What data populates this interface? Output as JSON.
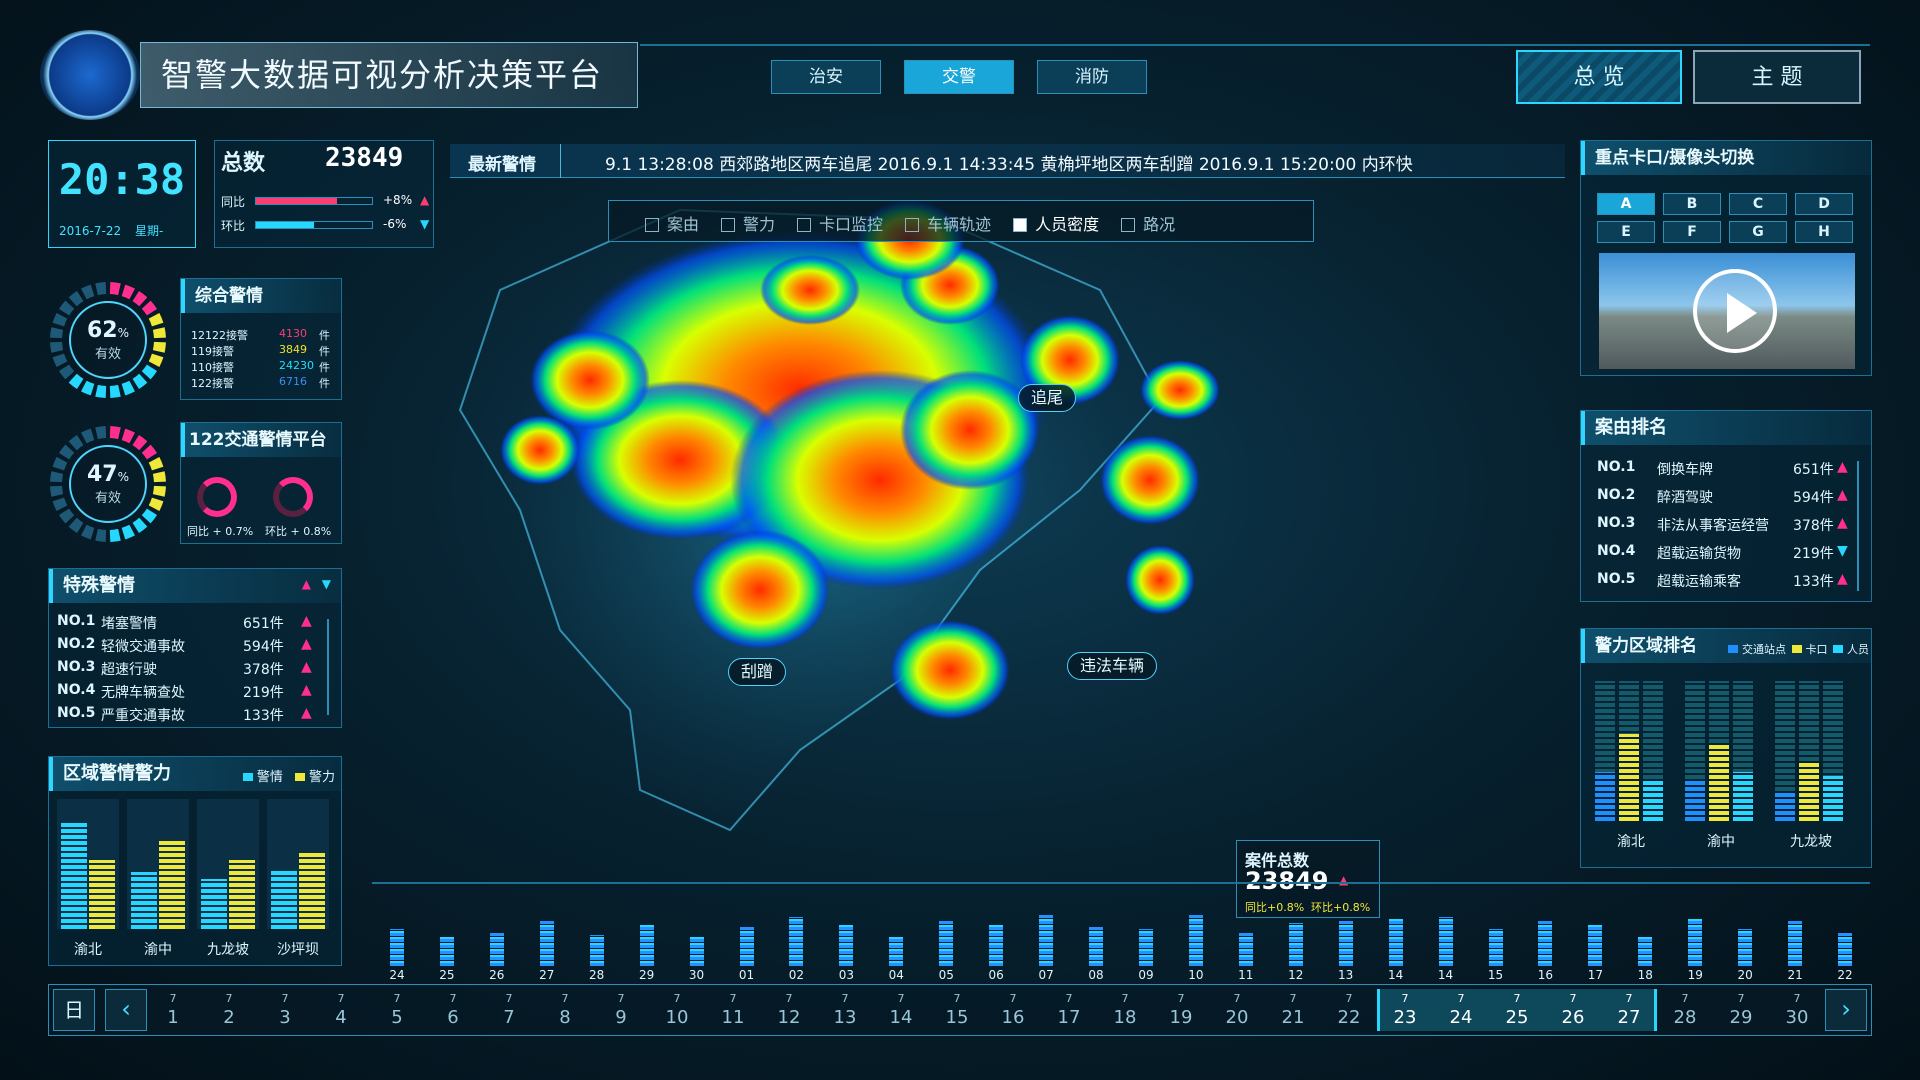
{
  "header": {
    "title": "智警大数据可视分析决策平台",
    "tabs": [
      "治安",
      "交警",
      "消防"
    ],
    "active_tab_index": 1,
    "right_buttons": [
      "总 览",
      "主 题"
    ]
  },
  "clock": {
    "time": "20:38",
    "date": "2016-7-22",
    "weekday": "星期-"
  },
  "totals": {
    "label": "总数",
    "value": "23849",
    "tongbi_label": "同比",
    "tongbi_value": "+8%",
    "tongbi_fill": 0.7,
    "huanbi_label": "环比",
    "huanbi_value": "-6%",
    "huanbi_fill": 0.5
  },
  "alerts": {
    "label": "最新警情",
    "ticker": "9.1 13:28:08 西郊路地区两车追尾    2016.9.1  14:33:45  黄桷坪地区两车刮蹭    2016.9.1  15:20:00  内环快"
  },
  "map_filters": [
    {
      "label": "案由",
      "checked": false
    },
    {
      "label": "警力",
      "checked": false
    },
    {
      "label": "卡口监控",
      "checked": false
    },
    {
      "label": "车辆轨迹",
      "checked": false
    },
    {
      "label": "人员密度",
      "checked": true
    },
    {
      "label": "路况",
      "checked": false
    }
  ],
  "map_tags": [
    "追尾",
    "刮蹭",
    "违法车辆"
  ],
  "zonghe": {
    "title": "综合警情",
    "ring_percent": "62",
    "ring_unit": "%",
    "ring_label": "有效",
    "ring_fraction": 0.62,
    "rows": [
      {
        "label": "12122接警",
        "value": "4130",
        "unit": "件",
        "color": "#ff3b74"
      },
      {
        "label": "119接警",
        "value": "3849",
        "unit": "件",
        "color": "#f3e22a"
      },
      {
        "label": "110接警",
        "value": "24230",
        "unit": "件",
        "color": "#20dfff"
      },
      {
        "label": "122接警",
        "value": "6716",
        "unit": "件",
        "color": "#3a8df4"
      }
    ]
  },
  "jiaotong": {
    "title": "122交通警情平台",
    "ring_percent": "47",
    "ring_unit": "%",
    "ring_label": "有效",
    "ring_fraction": 0.47,
    "tongbi": "同比 + 0.7%",
    "huanbi": "环比 + 0.8%"
  },
  "teshu": {
    "title": "特殊警情",
    "rows": [
      {
        "rank": "NO.1",
        "name": "堵塞警情",
        "count": "651件",
        "trend": "up"
      },
      {
        "rank": "NO.2",
        "name": "轻微交通事故",
        "count": "594件",
        "trend": "up"
      },
      {
        "rank": "NO.3",
        "name": "超速行驶",
        "count": "378件",
        "trend": "up"
      },
      {
        "rank": "NO.4",
        "name": "无牌车辆查处",
        "count": "219件",
        "trend": "up"
      },
      {
        "rank": "NO.5",
        "name": "严重交通事故",
        "count": "133件",
        "trend": "up"
      }
    ]
  },
  "quyu": {
    "title": "区域警情警力",
    "legend": [
      {
        "label": "警情",
        "color": "#26d8ff"
      },
      {
        "label": "警力",
        "color": "#f0e838"
      }
    ],
    "regions": [
      {
        "name": "渝北",
        "jingqing": 0.85,
        "jingli": 0.55
      },
      {
        "name": "渝中",
        "jingqing": 0.45,
        "jingli": 0.7
      },
      {
        "name": "九龙坡",
        "jingqing": 0.4,
        "jingli": 0.55
      },
      {
        "name": "沙坪坝",
        "jingqing": 0.48,
        "jingli": 0.62
      }
    ]
  },
  "kakou": {
    "title": "重点卡口/摄像头切换",
    "buttons": [
      "A",
      "B",
      "C",
      "D",
      "E",
      "F",
      "G",
      "H"
    ],
    "active": "A"
  },
  "anyou": {
    "title": "案由排名",
    "rows": [
      {
        "rank": "NO.1",
        "name": "倒换车牌",
        "count": "651件",
        "trend": "up"
      },
      {
        "rank": "NO.2",
        "name": "醉酒驾驶",
        "count": "594件",
        "trend": "up"
      },
      {
        "rank": "NO.3",
        "name": "非法从事客运经营",
        "count": "378件",
        "trend": "up"
      },
      {
        "rank": "NO.4",
        "name": "超载运输货物",
        "count": "219件",
        "trend": "down"
      },
      {
        "rank": "NO.5",
        "name": "超载运输乘客",
        "count": "133件",
        "trend": "up"
      }
    ]
  },
  "jingli_area": {
    "title": "警力区域排名",
    "legend": [
      {
        "label": "交通站点",
        "color": "#1e8fff"
      },
      {
        "label": "卡口",
        "color": "#f0e838"
      },
      {
        "label": "人员",
        "color": "#26d8ff"
      }
    ],
    "regions": [
      {
        "name": "渝北",
        "values": [
          0.35,
          0.62,
          0.3
        ]
      },
      {
        "name": "渝中",
        "values": [
          0.3,
          0.55,
          0.35
        ]
      },
      {
        "name": "九龙坡",
        "values": [
          0.2,
          0.42,
          0.32
        ]
      }
    ]
  },
  "case_total": {
    "label": "案件总数",
    "value": "23849",
    "tongbi": "同比+0.8%",
    "huanbi": "环比+0.8%"
  },
  "timeline": {
    "labels": [
      "24",
      "25",
      "26",
      "27",
      "28",
      "29",
      "30",
      "01",
      "02",
      "03",
      "04",
      "05",
      "06",
      "07",
      "08",
      "09",
      "10",
      "11",
      "12",
      "13",
      "14",
      "14",
      "15",
      "16",
      "17",
      "18",
      "19",
      "20",
      "21",
      "22"
    ],
    "heights": [
      0.45,
      0.35,
      0.4,
      0.55,
      0.38,
      0.5,
      0.35,
      0.48,
      0.6,
      0.5,
      0.35,
      0.55,
      0.5,
      0.62,
      0.48,
      0.45,
      0.62,
      0.4,
      0.52,
      0.55,
      0.58,
      0.6,
      0.45,
      0.55,
      0.5,
      0.35,
      0.58,
      0.45,
      0.55,
      0.4
    ]
  },
  "date_bar": {
    "mode_label": "日",
    "month": "7",
    "days": [
      "1",
      "2",
      "3",
      "4",
      "5",
      "6",
      "7",
      "8",
      "9",
      "10",
      "11",
      "12",
      "13",
      "14",
      "15",
      "16",
      "17",
      "18",
      "19",
      "20",
      "21",
      "22",
      "23",
      "24",
      "25",
      "26",
      "27",
      "28",
      "29",
      "30"
    ],
    "selected_start": "23",
    "selected_end": "27"
  }
}
